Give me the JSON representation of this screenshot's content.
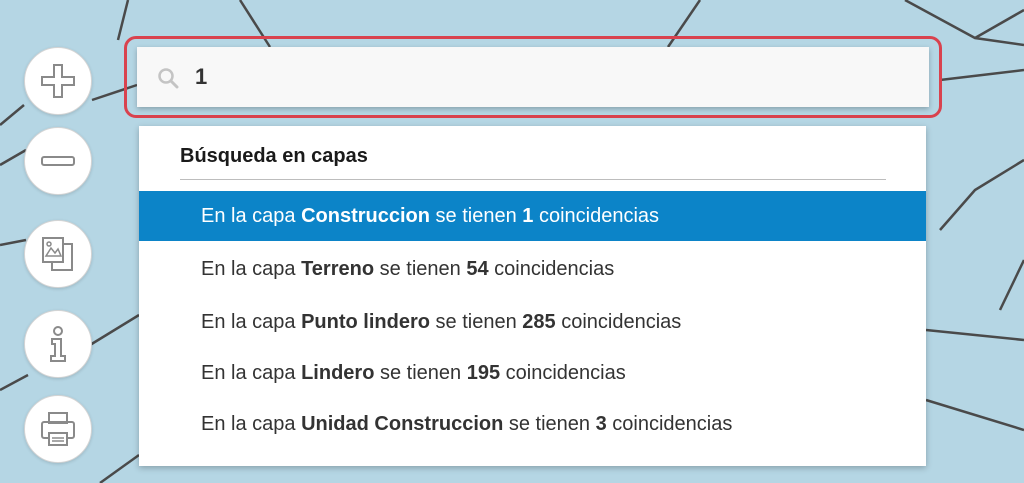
{
  "search": {
    "value": "1"
  },
  "results": {
    "heading": "Búsqueda en capas",
    "selected_index": 0,
    "items": [
      {
        "prefix": "En la capa",
        "layer": "Construccion",
        "middle": "se tienen",
        "count": "1",
        "suffix": "coincidencias"
      },
      {
        "prefix": "En la capa",
        "layer": "Terreno",
        "middle": "se tienen",
        "count": "54",
        "suffix": "coincidencias"
      },
      {
        "prefix": "En la capa",
        "layer": "Punto lindero",
        "middle": "se tienen",
        "count": "285",
        "suffix": "coincidencias"
      },
      {
        "prefix": "En la capa",
        "layer": "Lindero",
        "middle": "se tienen",
        "count": "195",
        "suffix": "coincidencias"
      },
      {
        "prefix": "En la capa",
        "layer": "Unidad Construccion",
        "middle": "se tienen",
        "count": "3",
        "suffix": "coincidencias"
      }
    ]
  },
  "map_tools": [
    {
      "name": "zoom-in-button",
      "icon": "plus-icon"
    },
    {
      "name": "zoom-out-button",
      "icon": "minus-icon"
    },
    {
      "name": "layers-button",
      "icon": "layers-icon"
    },
    {
      "name": "info-button",
      "icon": "info-icon"
    },
    {
      "name": "print-button",
      "icon": "printer-icon"
    }
  ],
  "colors": {
    "map_background": "#b5d6e4",
    "map_lines": "#4a4a4a",
    "highlight_border": "#d9424e",
    "selected_row": "#0c84c8"
  }
}
